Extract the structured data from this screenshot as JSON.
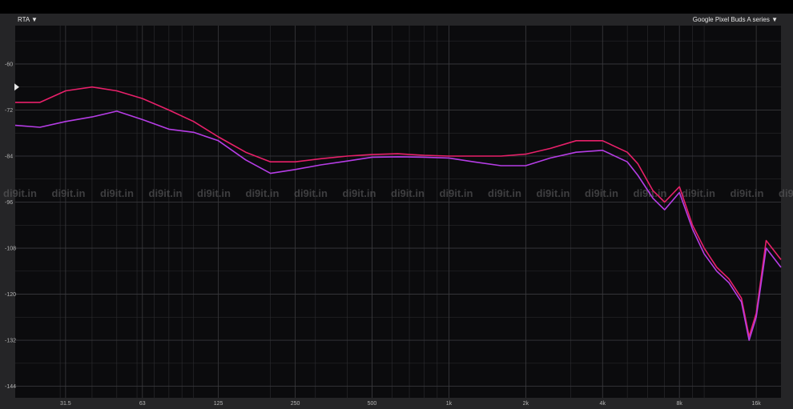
{
  "toolbar": {
    "rta_label": "RTA ▼",
    "device_label": "Google Pixel Buds A series ▼"
  },
  "watermark": "di9it.in",
  "colors": {
    "background": "#0b0b0d",
    "frame": "#252527",
    "grid": "#2e2e31",
    "series_1": "#e8206a",
    "series_2": "#b63de6"
  },
  "chart_data": {
    "type": "line",
    "title": "",
    "xlabel": "",
    "ylabel": "",
    "x_scale": "log",
    "xlim": [
      20,
      20000
    ],
    "ylim": [
      -147,
      -50
    ],
    "grid": true,
    "legend": "none",
    "x_ticks": [
      31.5,
      63,
      125,
      250,
      500,
      1000,
      2000,
      4000,
      8000,
      16000
    ],
    "x_tick_labels": [
      "31.5",
      "63",
      "125",
      "250",
      "500",
      "1k",
      "2k",
      "4k",
      "8k",
      "16k"
    ],
    "y_ticks": [
      -60,
      -72,
      -84,
      -96,
      -108,
      -120,
      -132,
      -144
    ],
    "y_tick_labels": [
      "-60",
      "-72",
      "-84",
      "-96",
      "-108",
      "-120",
      "-132",
      "-144"
    ],
    "marker_level": -66,
    "x": [
      20,
      25,
      31.5,
      40,
      50,
      63,
      80,
      100,
      125,
      160,
      200,
      250,
      315,
      400,
      500,
      630,
      800,
      1000,
      1250,
      1600,
      2000,
      2500,
      3150,
      4000,
      5000,
      5500,
      6300,
      7000,
      8000,
      9000,
      10000,
      11200,
      12500,
      14000,
      15000,
      16000,
      17500,
      20000
    ],
    "series": [
      {
        "values": [
          -70,
          -70,
          -67,
          -66,
          -67,
          -69,
          -72,
          -75,
          -79,
          -83,
          -85.5,
          -85.5,
          -84.7,
          -84,
          -83.6,
          -83.4,
          -83.8,
          -84,
          -84,
          -84,
          -83.5,
          -82,
          -80,
          -80,
          -83,
          -86,
          -93,
          -96,
          -92,
          -102,
          -108,
          -113,
          -116,
          -121,
          -131,
          -125,
          -106,
          -111
        ],
        "color": "#e8206a"
      },
      {
        "values": [
          -76,
          -76.5,
          -75,
          -73.8,
          -72.3,
          -74.5,
          -77,
          -77.8,
          -80,
          -85,
          -88.5,
          -87.5,
          -86.3,
          -85.3,
          -84.3,
          -84.2,
          -84.3,
          -84.5,
          -85.5,
          -86.5,
          -86.5,
          -84.5,
          -83,
          -82.5,
          -85.5,
          -89,
          -95,
          -98,
          -93.5,
          -103,
          -109.5,
          -114,
          -117,
          -122,
          -132,
          -126,
          -108,
          -113
        ],
        "color": "#b63de6"
      }
    ]
  }
}
